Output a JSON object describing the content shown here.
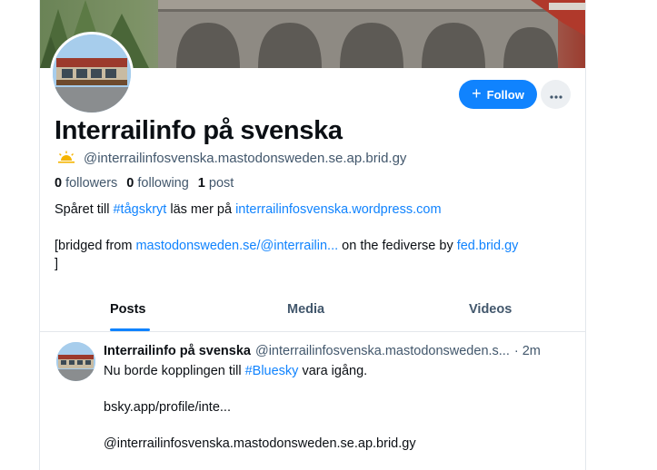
{
  "profile": {
    "display_name": "Interrailinfo på svenska",
    "handle": "@interrailinfosvenska.mastodonsweden.se.ap.brid.gy",
    "handle_emoji": "🌅",
    "stats": {
      "followers_count": "0",
      "followers_label": "followers",
      "following_count": "0",
      "following_label": "following",
      "posts_count": "1",
      "posts_label": "post"
    },
    "bio": {
      "line1_prefix": "Spåret till ",
      "line1_tag": "#tågskryt",
      "line1_middle": " läs mer på ",
      "line1_link": "interrailinfosvenska.wordpress.com",
      "line2_prefix": "[bridged from ",
      "line2_link": "mastodonsweden.se/@interrailin...",
      "line2_middle": " on the fediverse by ",
      "line2_link2": "fed.brid.gy",
      "line3": "]"
    }
  },
  "actions": {
    "follow_label": "Follow",
    "follow_icon": "plus-icon",
    "more_icon": "ellipsis-icon"
  },
  "tabs": [
    {
      "label": "Posts",
      "active": true
    },
    {
      "label": "Media",
      "active": false
    },
    {
      "label": "Videos",
      "active": false
    }
  ],
  "post": {
    "author": "Interrailinfo på svenska",
    "handle": "@interrailinfosvenska.mastodonsweden.s...",
    "time": "· 2m",
    "text_prefix": "Nu borde kopplingen till ",
    "text_tag": "#Bluesky",
    "text_suffix": " vara igång.",
    "link": "bsky.app/profile/inte...",
    "mention": "@interrailinfosvenska.mastodonsweden.se.ap.brid.gy"
  },
  "colors": {
    "accent": "#1083fe",
    "text_primary": "#0b0f14",
    "text_secondary": "#42576c",
    "border": "#e3e7ec"
  }
}
